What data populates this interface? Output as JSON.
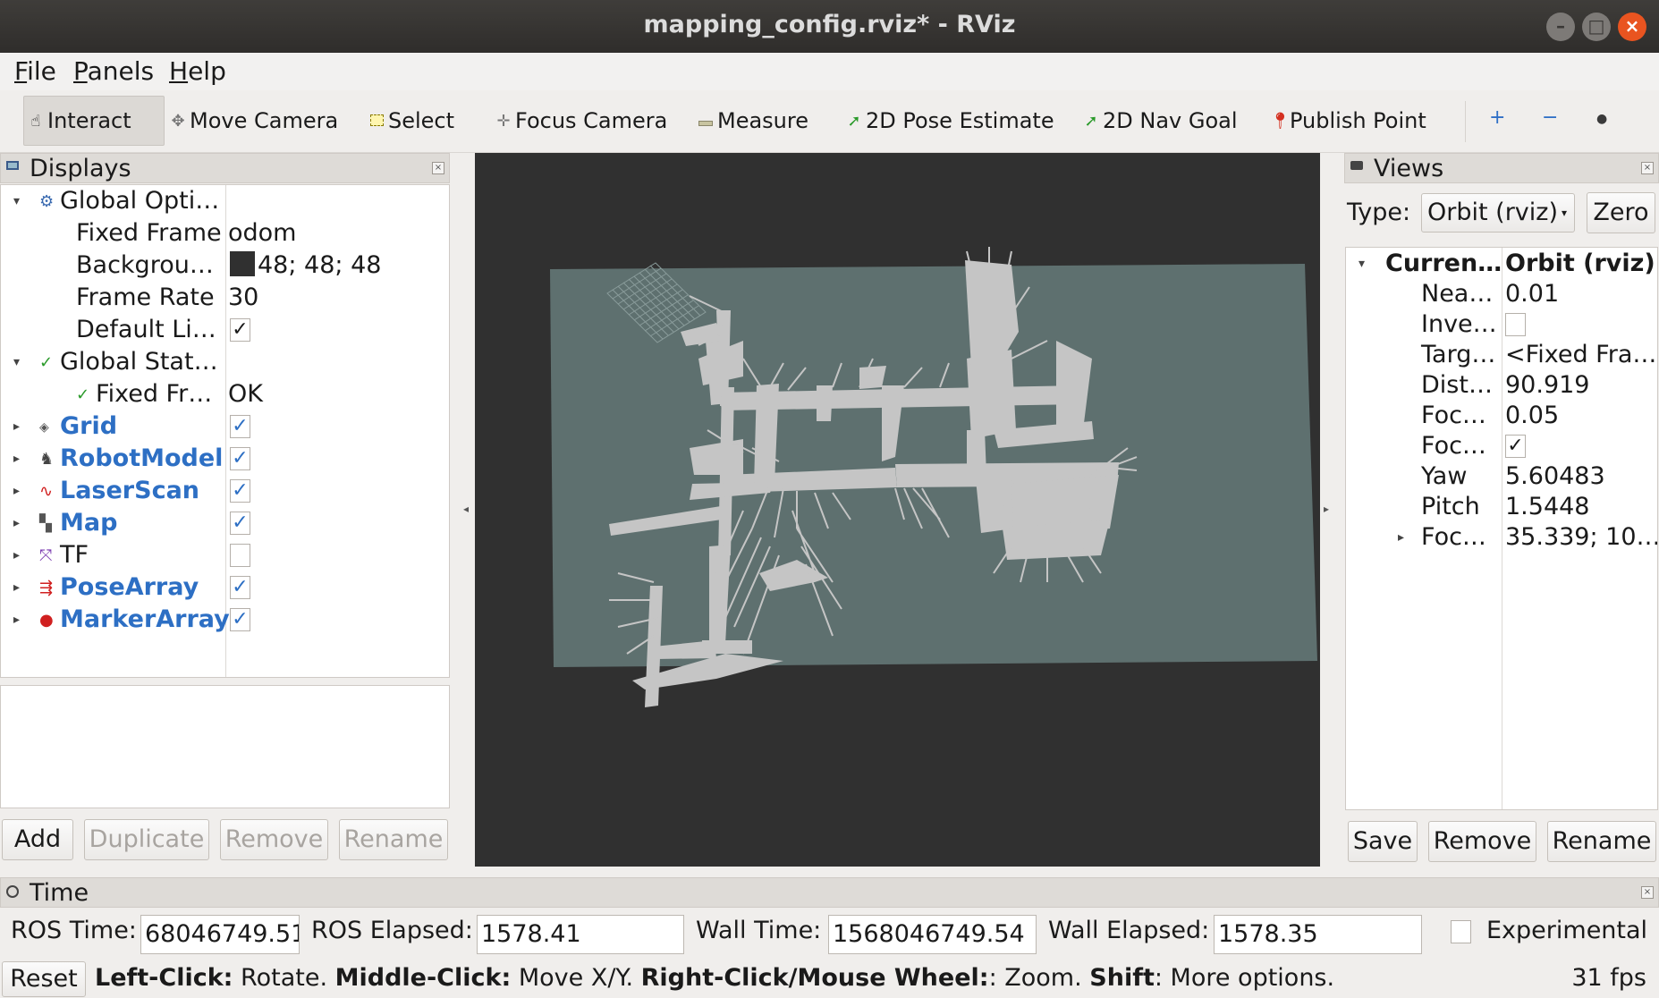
{
  "window": {
    "title": "mapping_config.rviz* - RViz"
  },
  "menu": [
    {
      "label": "File",
      "accel": "F",
      "rest": "ile"
    },
    {
      "label": "Panels",
      "accel": "P",
      "rest": "anels"
    },
    {
      "label": "Help",
      "accel": "H",
      "rest": "elp"
    }
  ],
  "toolbar": {
    "interact": "Interact",
    "move_camera": "Move Camera",
    "select": "Select",
    "focus_camera": "Focus Camera",
    "measure": "Measure",
    "pose_estimate": "2D Pose Estimate",
    "nav_goal": "2D Nav Goal",
    "publish_point": "Publish Point",
    "add_tool": "+",
    "remove_tool": "−",
    "view_tool": "●"
  },
  "displays": {
    "title": "Displays",
    "global_options": {
      "label": "Global Opti…",
      "fixed_frame_label": "Fixed Frame",
      "fixed_frame_value": "odom",
      "background_label": "Backgrou…",
      "background_value": "48; 48; 48",
      "background_color": "#303030",
      "frame_rate_label": "Frame Rate",
      "frame_rate_value": "30",
      "default_light_label": "Default Li…",
      "default_light_checked": "✓"
    },
    "global_status": {
      "label": "Global Stat…",
      "fixed_frame_label": "Fixed Fr…",
      "fixed_frame_value": "OK"
    },
    "items": [
      {
        "name": "Grid",
        "checked": "✓"
      },
      {
        "name": "RobotModel",
        "checked": "✓"
      },
      {
        "name": "LaserScan",
        "checked": "✓"
      },
      {
        "name": "Map",
        "checked": "✓"
      },
      {
        "name": "TF",
        "checked": ""
      },
      {
        "name": "PoseArray",
        "checked": "✓"
      },
      {
        "name": "MarkerArray",
        "checked": "✓"
      }
    ],
    "buttons": {
      "add": "Add",
      "duplicate": "Duplicate",
      "remove": "Remove",
      "rename": "Rename"
    }
  },
  "views": {
    "title": "Views",
    "type_label": "Type:",
    "type_value": "Orbit (rviz)",
    "zero_label": "Zero",
    "current_label": "Curren…",
    "current_value": "Orbit (rviz)",
    "props": [
      {
        "name": "Nea…",
        "value": "0.01"
      },
      {
        "name": "Inve…",
        "value": ""
      },
      {
        "name": "Targ…",
        "value": "<Fixed Fra…"
      },
      {
        "name": "Dist…",
        "value": "90.919"
      },
      {
        "name": "Foc…",
        "value": "0.05"
      },
      {
        "name": "Foc…",
        "value": "✓"
      },
      {
        "name": "Yaw",
        "value": "5.60483"
      },
      {
        "name": "Pitch",
        "value": "1.5448"
      },
      {
        "name": "Foc…",
        "value": "35.339; 10…"
      }
    ],
    "buttons": {
      "save": "Save",
      "remove": "Remove",
      "rename": "Rename"
    }
  },
  "time": {
    "title": "Time",
    "ros_time_label": "ROS Time:",
    "ros_time_value": "68046749.51",
    "ros_elapsed_label": "ROS Elapsed:",
    "ros_elapsed_value": "1578.41",
    "wall_time_label": "Wall Time:",
    "wall_time_value": "1568046749.54",
    "wall_elapsed_label": "Wall Elapsed:",
    "wall_elapsed_value": "1578.35",
    "experimental_label": "Experimental"
  },
  "status": {
    "reset_label": "Reset",
    "left_click_key": "Left-Click:",
    "left_click_action": " Rotate. ",
    "middle_click_key": "Middle-Click:",
    "middle_click_action": " Move X/Y. ",
    "right_click_key": "Right-Click/Mouse Wheel:",
    "right_click_action": ": Zoom. ",
    "shift_key": "Shift",
    "shift_action": ": More options.",
    "fps": "31 fps"
  },
  "colors": {
    "map_ground": "#5e706f",
    "map_free": "#c5c5c5",
    "viewport_bg": "#303030",
    "accent_blue": "#2d6fc4",
    "close_orange": "#e95420"
  }
}
